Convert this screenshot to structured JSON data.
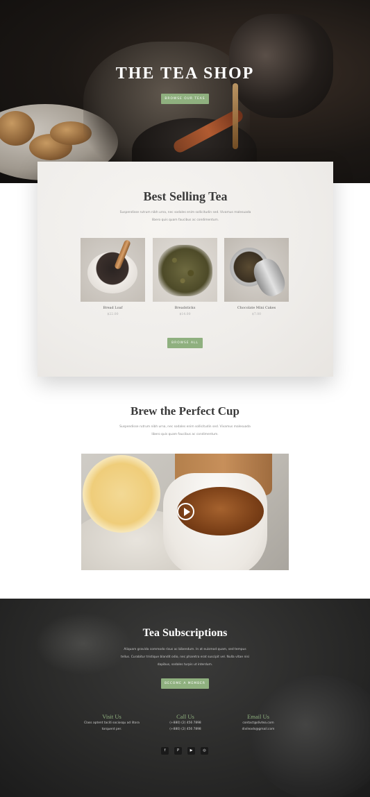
{
  "hero": {
    "title": "THE TEA SHOP",
    "button_label": "BROWSE OUR TEAS"
  },
  "best_selling": {
    "title": "Best Selling Tea",
    "text_line1": "Suspendisse rutrum nibh urna, nec sodales enim sollicitudin sed. Vivamus malesuada",
    "text_line2": "libero quis quam faucibus ac condimentum.",
    "products": [
      {
        "name": "Bread Loaf",
        "price": "$22.00",
        "image": "mortar-with-tea"
      },
      {
        "name": "Breadsticks",
        "price": "$14.00",
        "image": "loose-green-tea"
      },
      {
        "name": "Chocolate Mini Cakes",
        "price": "$7.00",
        "image": "tea-tin"
      }
    ],
    "button_label": "BROWSE ALL"
  },
  "brew": {
    "title": "Brew the Perfect Cup",
    "text_line1": "Suspendisse rutrum nibh urna, nec sodales enim sollicitudin sed. Vivamus malesuada",
    "text_line2": "libero quis quam faucibus ac condimentum.",
    "video_icon": "play-icon"
  },
  "subscriptions": {
    "title": "Tea Subscriptions",
    "text_line1": "Aliquam gravida commodo risus ac bibendum. In at euismod quam, sed tempus",
    "text_line2": "tellus. Curabitur tristique blandit odio, nec pharetra erat suscipit vel. Nulla vitae nisi",
    "text_line3": "dapibus, sodales turpis ut interdum.",
    "button_label": "BECOME A MEMBER",
    "contacts": [
      {
        "label": "Visit Us",
        "line1": "Class aptent taciti sociosqu ad litora",
        "line2": "torquent per."
      },
      {
        "label": "Call Us",
        "line1": "(+880) (2) 456 7898",
        "line2": "(+880) (2) 456 7898"
      },
      {
        "label": "Email Us",
        "line1": "contact@divtea.com",
        "line2": "divileads@gmail.com"
      }
    ],
    "socials": [
      {
        "icon": "facebook-icon",
        "glyph": "f"
      },
      {
        "icon": "pinterest-icon",
        "glyph": "P"
      },
      {
        "icon": "youtube-icon",
        "glyph": "▶"
      },
      {
        "icon": "instagram-icon",
        "glyph": "◎"
      }
    ]
  },
  "colors": {
    "accent": "#8fb07f",
    "hero_bg": "#1b1714",
    "footer_bg": "#2a2a29"
  }
}
